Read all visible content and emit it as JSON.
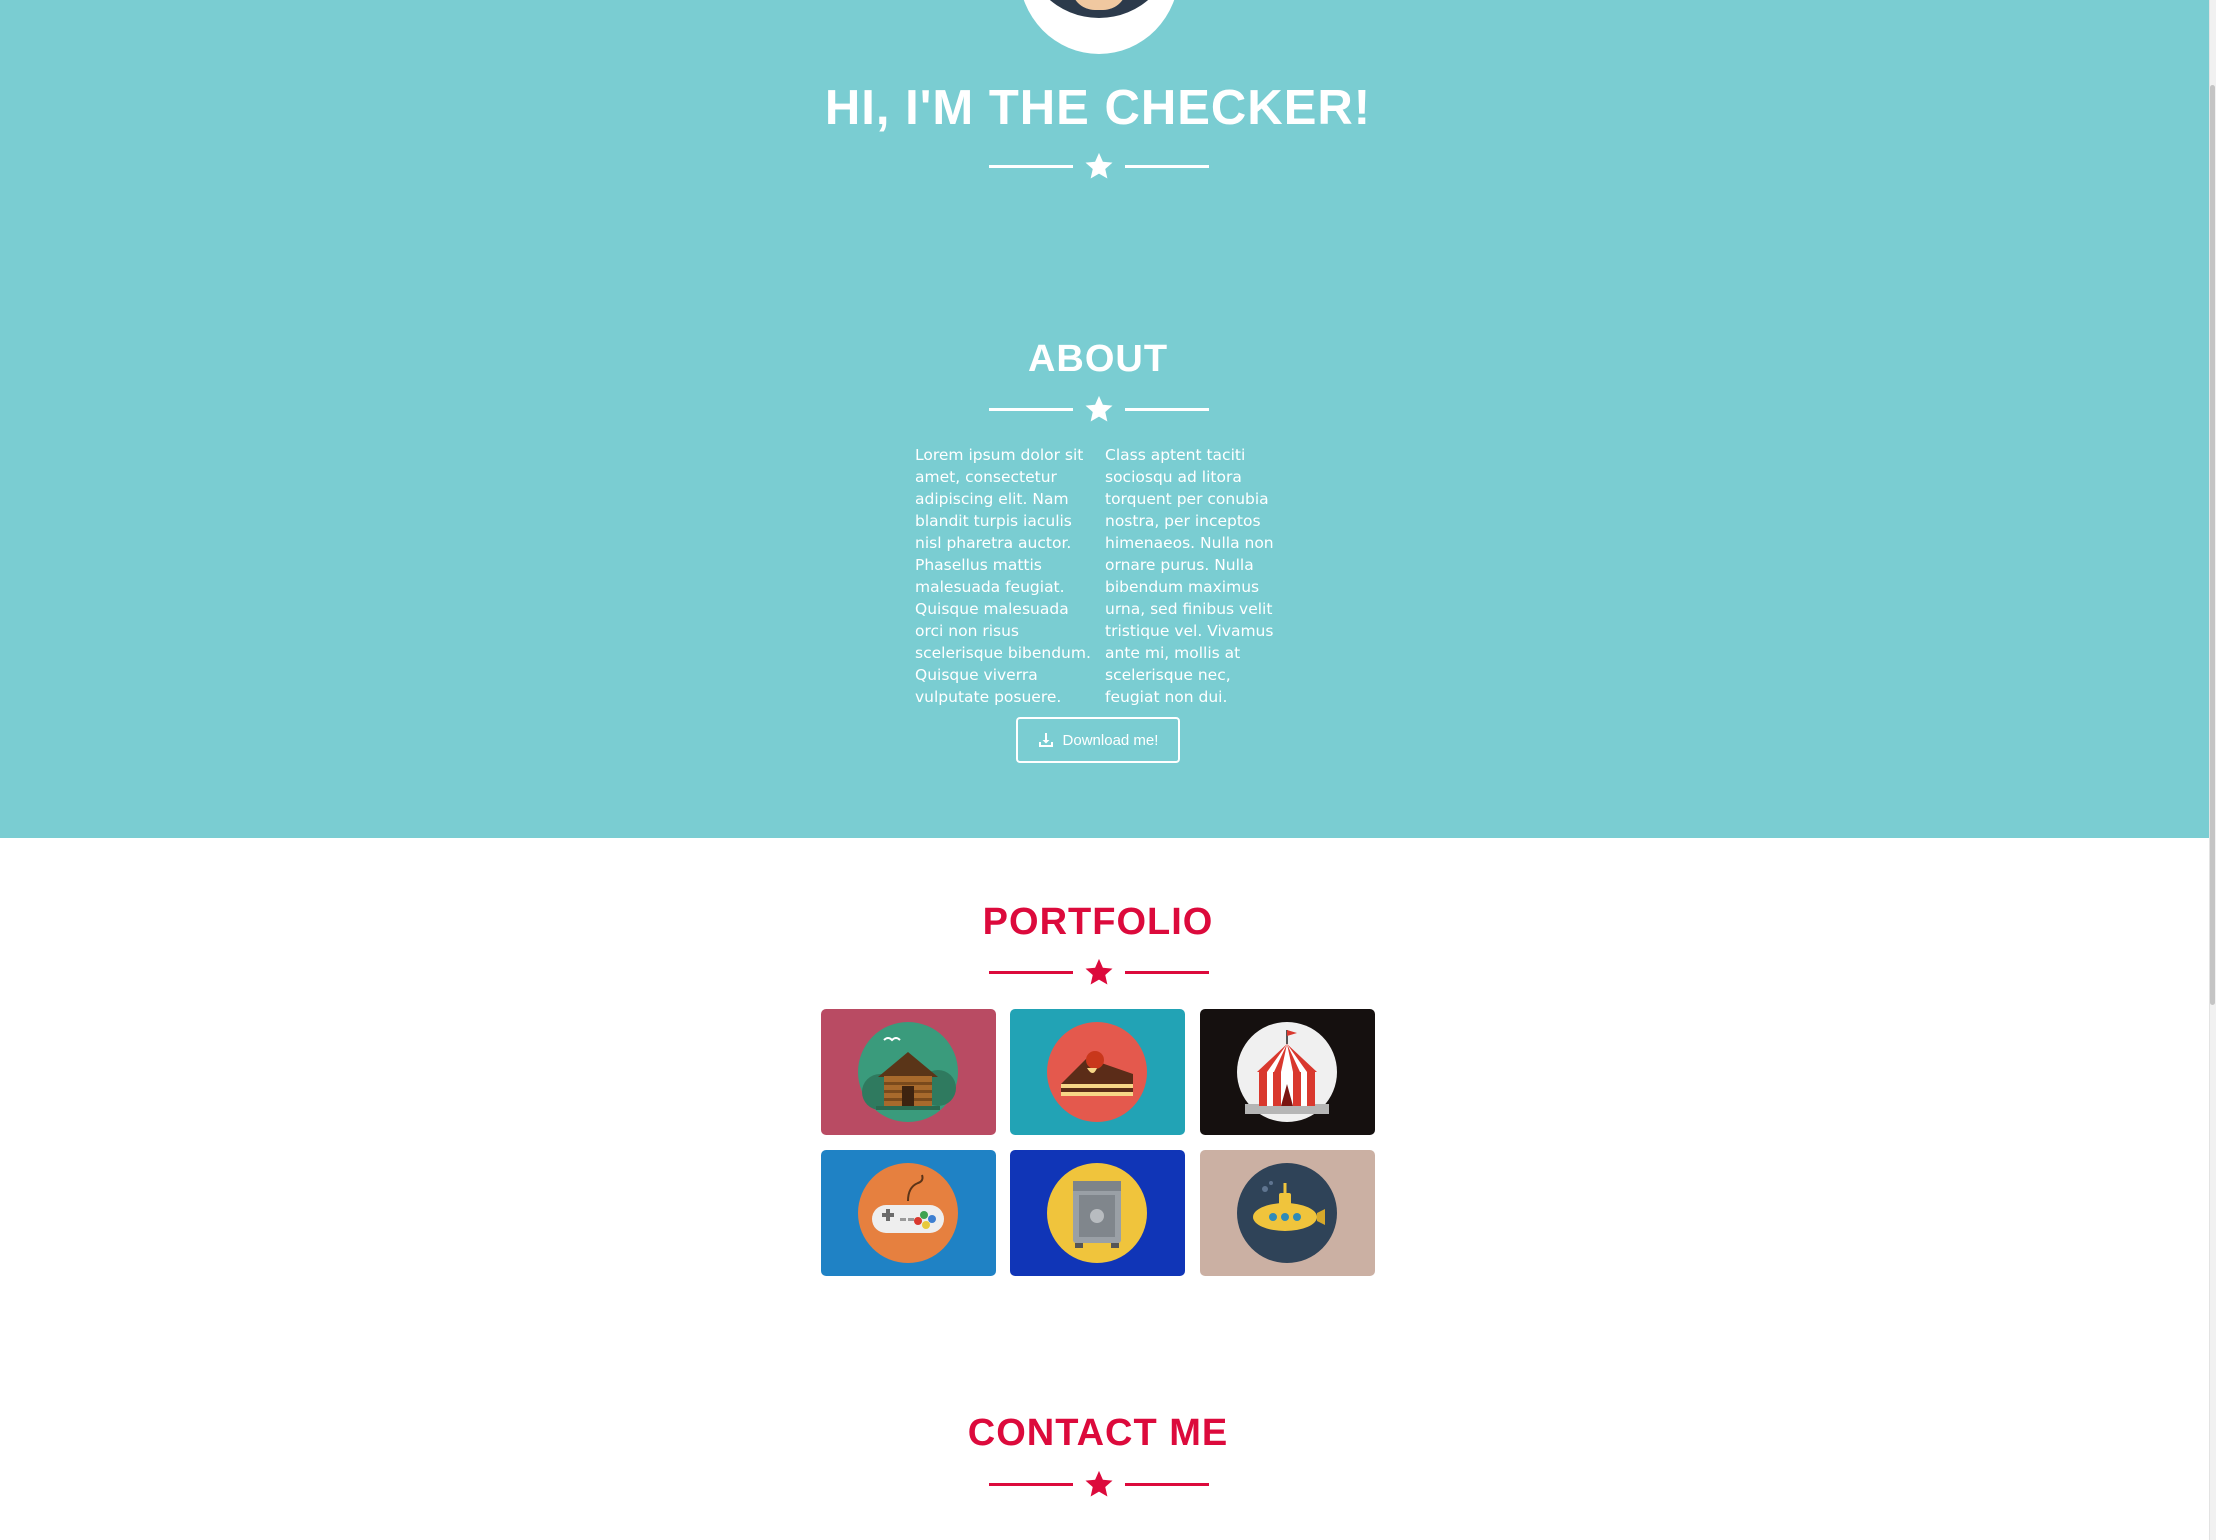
{
  "hero": {
    "title": "HI, I'M THE CHECKER!"
  },
  "about": {
    "title": "ABOUT",
    "col_left": "Lorem ipsum dolor sit amet, consectetur adipiscing elit. Nam blandit turpis iaculis nisl pharetra auctor. Phasellus mattis malesuada feugiat. Quisque malesuada orci non risus scelerisque bibendum. Quisque viverra vulputate posuere.",
    "col_right": "Class aptent taciti sociosqu ad litora torquent per conubia nostra, per inceptos himenaeos. Nulla non ornare purus. Nulla bibendum maximus urna, sed finibus velit tristique vel. Vivamus ante mi, mollis at scelerisque nec, feugiat non dui.",
    "download_label": "Download me!"
  },
  "portfolio": {
    "title": "PORTFOLIO",
    "items": [
      {
        "icon": "cabin-icon",
        "bg": "#b94b63"
      },
      {
        "icon": "cake-icon",
        "bg": "#22a3b5"
      },
      {
        "icon": "circus-tent-icon",
        "bg": "#15100f"
      },
      {
        "icon": "game-controller-icon",
        "bg": "#1f82c5"
      },
      {
        "icon": "safe-icon",
        "bg": "#1035b7"
      },
      {
        "icon": "submarine-icon",
        "bg": "#cbb0a3"
      }
    ]
  },
  "contact": {
    "title": "CONTACT ME"
  },
  "colors": {
    "hero_bg": "#7acdd2",
    "accent": "#dc0a3c"
  }
}
